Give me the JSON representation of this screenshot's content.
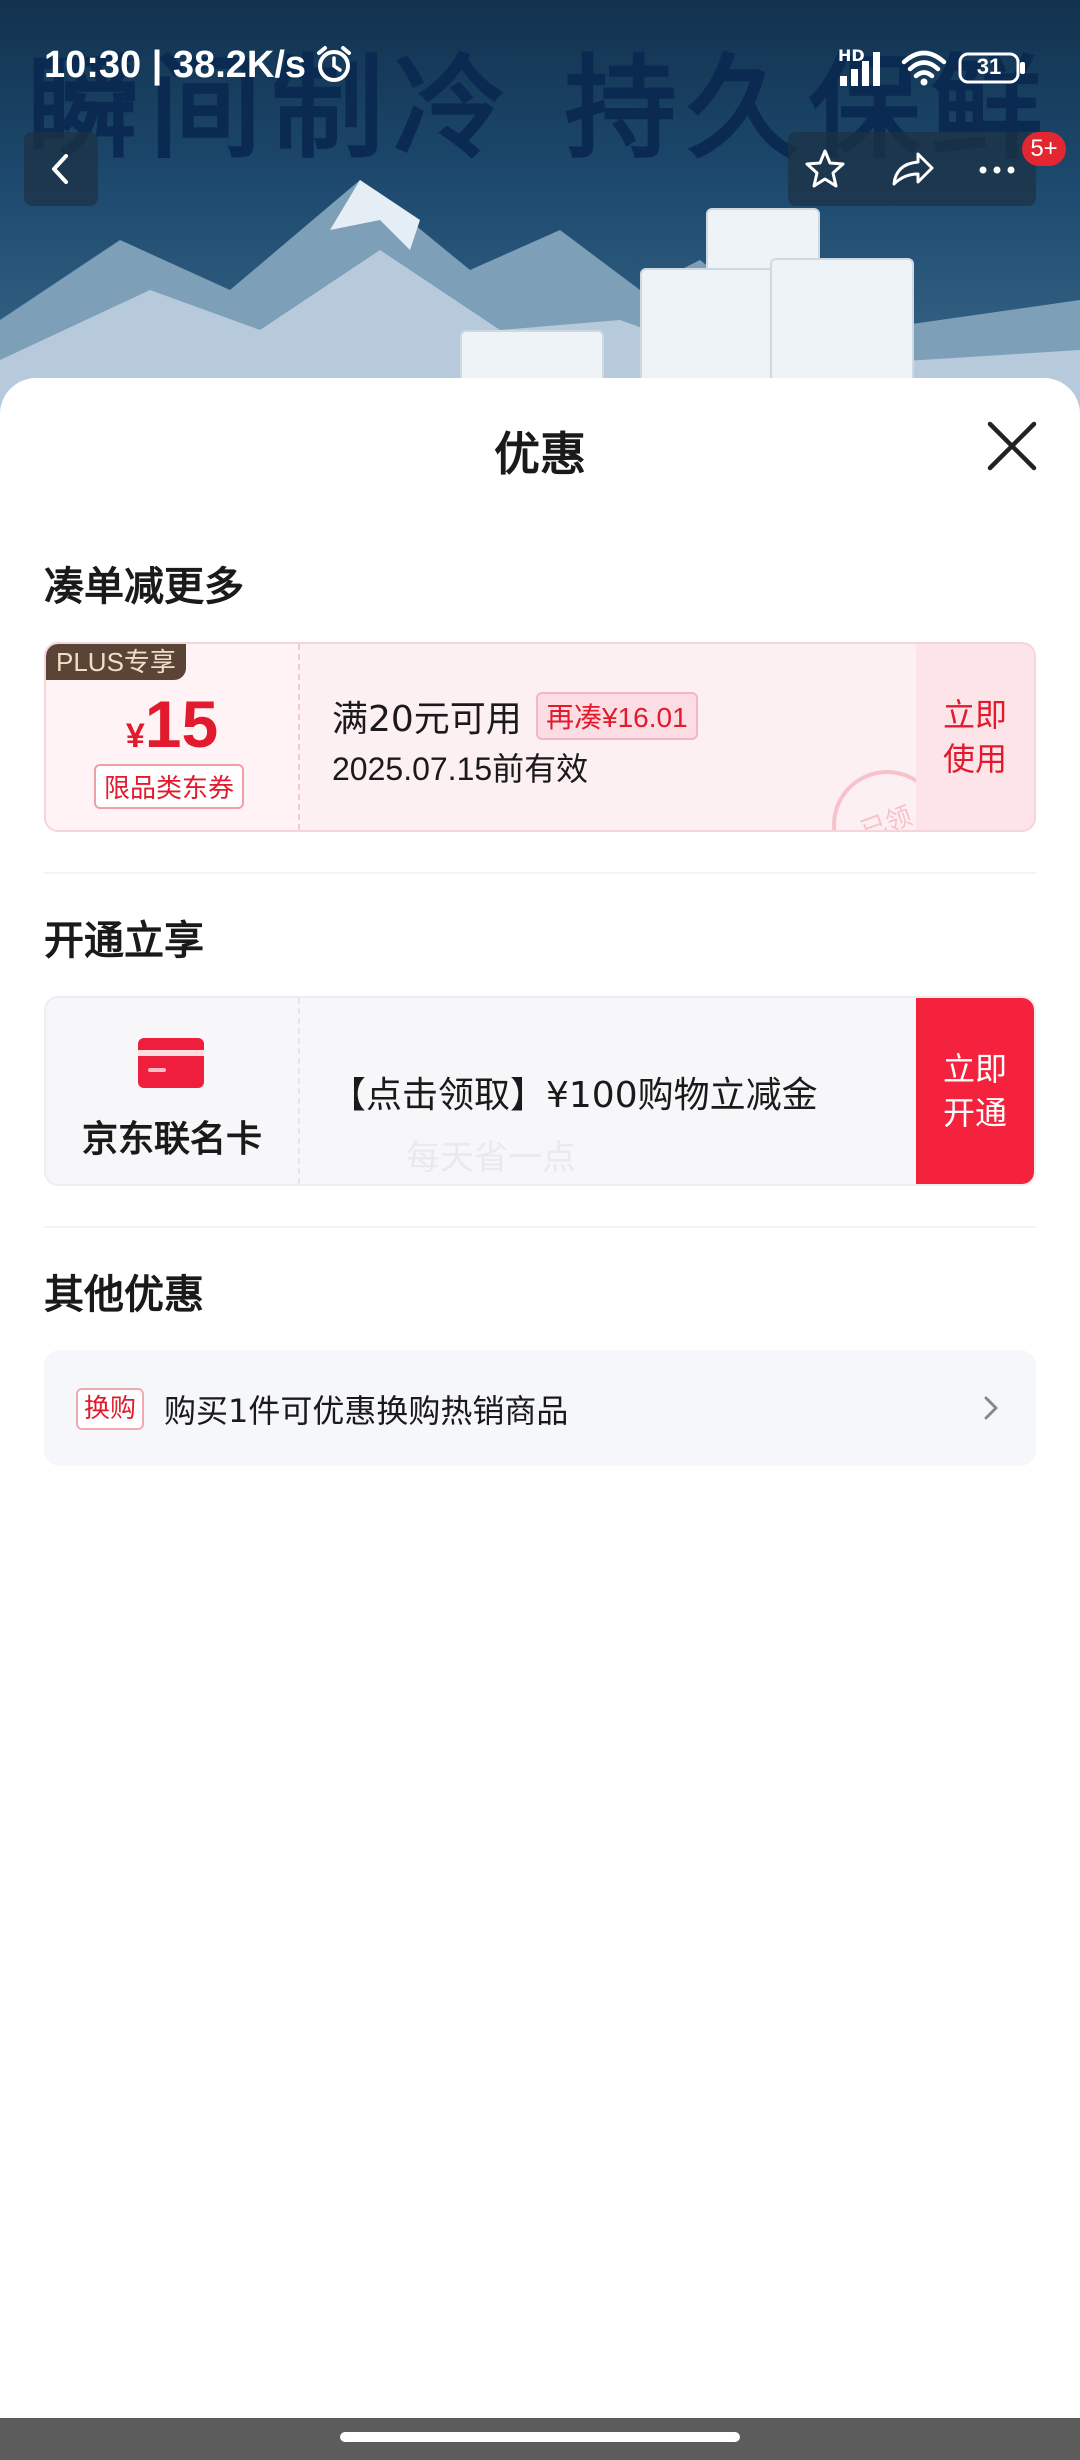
{
  "background": {
    "slogan": "瞬间制冷  持久保鲜",
    "cart_badge": "5+"
  },
  "status_bar": {
    "time_speed": "10:30 | 38.2K/s",
    "hd": "HD",
    "battery": "31"
  },
  "sheet": {
    "title": "优惠",
    "sections": {
      "more": "凑单减更多",
      "open": "开通立享",
      "other": "其他优惠"
    },
    "coupon": {
      "plus_tag": "PLUS专享",
      "currency": "¥",
      "amount": "15",
      "type": "限品类东券",
      "condition": "满20元可用",
      "more": "再凑¥16.01",
      "validity": "2025.07.15前有效",
      "stamp": "已领",
      "button": "立即使用"
    },
    "card_offer": {
      "name": "京东联名卡",
      "description": "【点击领取】¥100购物立减金",
      "watermark": "每天省一点",
      "button": "立即开通"
    },
    "other_offer": {
      "tag": "换购",
      "text": "购买1件可优惠换购热销商品"
    }
  },
  "colors": {
    "accent_red": "#e21a2d",
    "button_red": "#f5223d",
    "plus_brown": "#5a4437"
  }
}
